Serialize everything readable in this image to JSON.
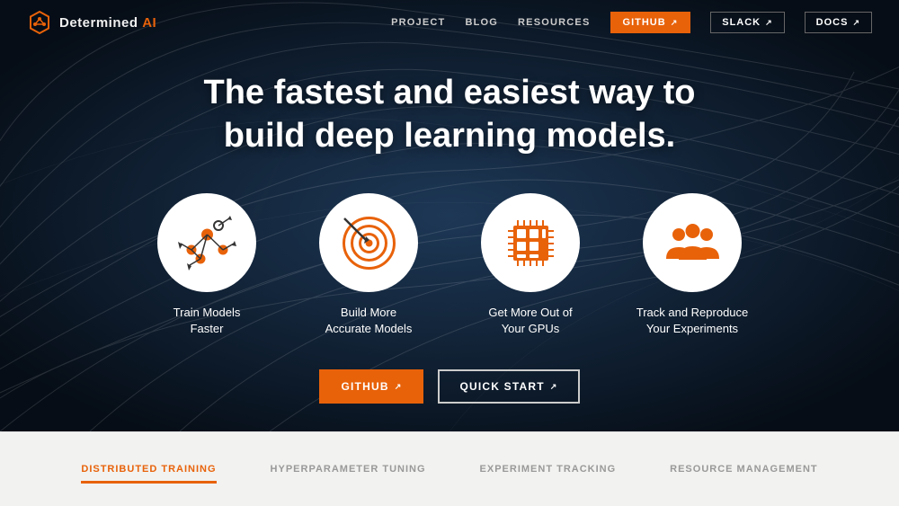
{
  "brand": {
    "name": "Determined",
    "name_accent": "AI",
    "logo_alt": "Determined AI logo"
  },
  "nav": {
    "links": [
      {
        "label": "PROJECT",
        "id": "project"
      },
      {
        "label": "BLOG",
        "id": "blog"
      },
      {
        "label": "RESOURCES",
        "id": "resources"
      }
    ],
    "github_label": "GITHUB",
    "slack_label": "SLACK",
    "docs_label": "DOCS"
  },
  "hero": {
    "title_line1": "The fastest and easiest way to",
    "title_line2": "build deep learning models.",
    "features": [
      {
        "id": "train",
        "label": "Train Models\nFaster",
        "label_line1": "Train Models",
        "label_line2": "Faster",
        "icon": "network"
      },
      {
        "id": "accurate",
        "label": "Build More\nAccurate Models",
        "label_line1": "Build More",
        "label_line2": "Accurate Models",
        "icon": "target"
      },
      {
        "id": "gpu",
        "label": "Get More Out of\nYour GPUs",
        "label_line1": "Get More Out of",
        "label_line2": "Your GPUs",
        "icon": "chip"
      },
      {
        "id": "track",
        "label": "Track and Reproduce\nYour Experiments",
        "label_line1": "Track and Reproduce",
        "label_line2": "Your Experiments",
        "icon": "team"
      }
    ],
    "github_button": "GITHUB",
    "quickstart_button": "QUICK START"
  },
  "tabs": [
    {
      "label": "DISTRIBUTED TRAINING",
      "id": "distributed",
      "active": true
    },
    {
      "label": "HYPERPARAMETER TUNING",
      "id": "hyperparameter",
      "active": false
    },
    {
      "label": "EXPERIMENT TRACKING",
      "id": "experiment",
      "active": false
    },
    {
      "label": "RESOURCE MANAGEMENT",
      "id": "resource",
      "active": false
    }
  ],
  "colors": {
    "orange": "#e8620a",
    "dark_bg": "#0d1b2a",
    "text_white": "#ffffff",
    "light_bg": "#f2f2f0"
  }
}
